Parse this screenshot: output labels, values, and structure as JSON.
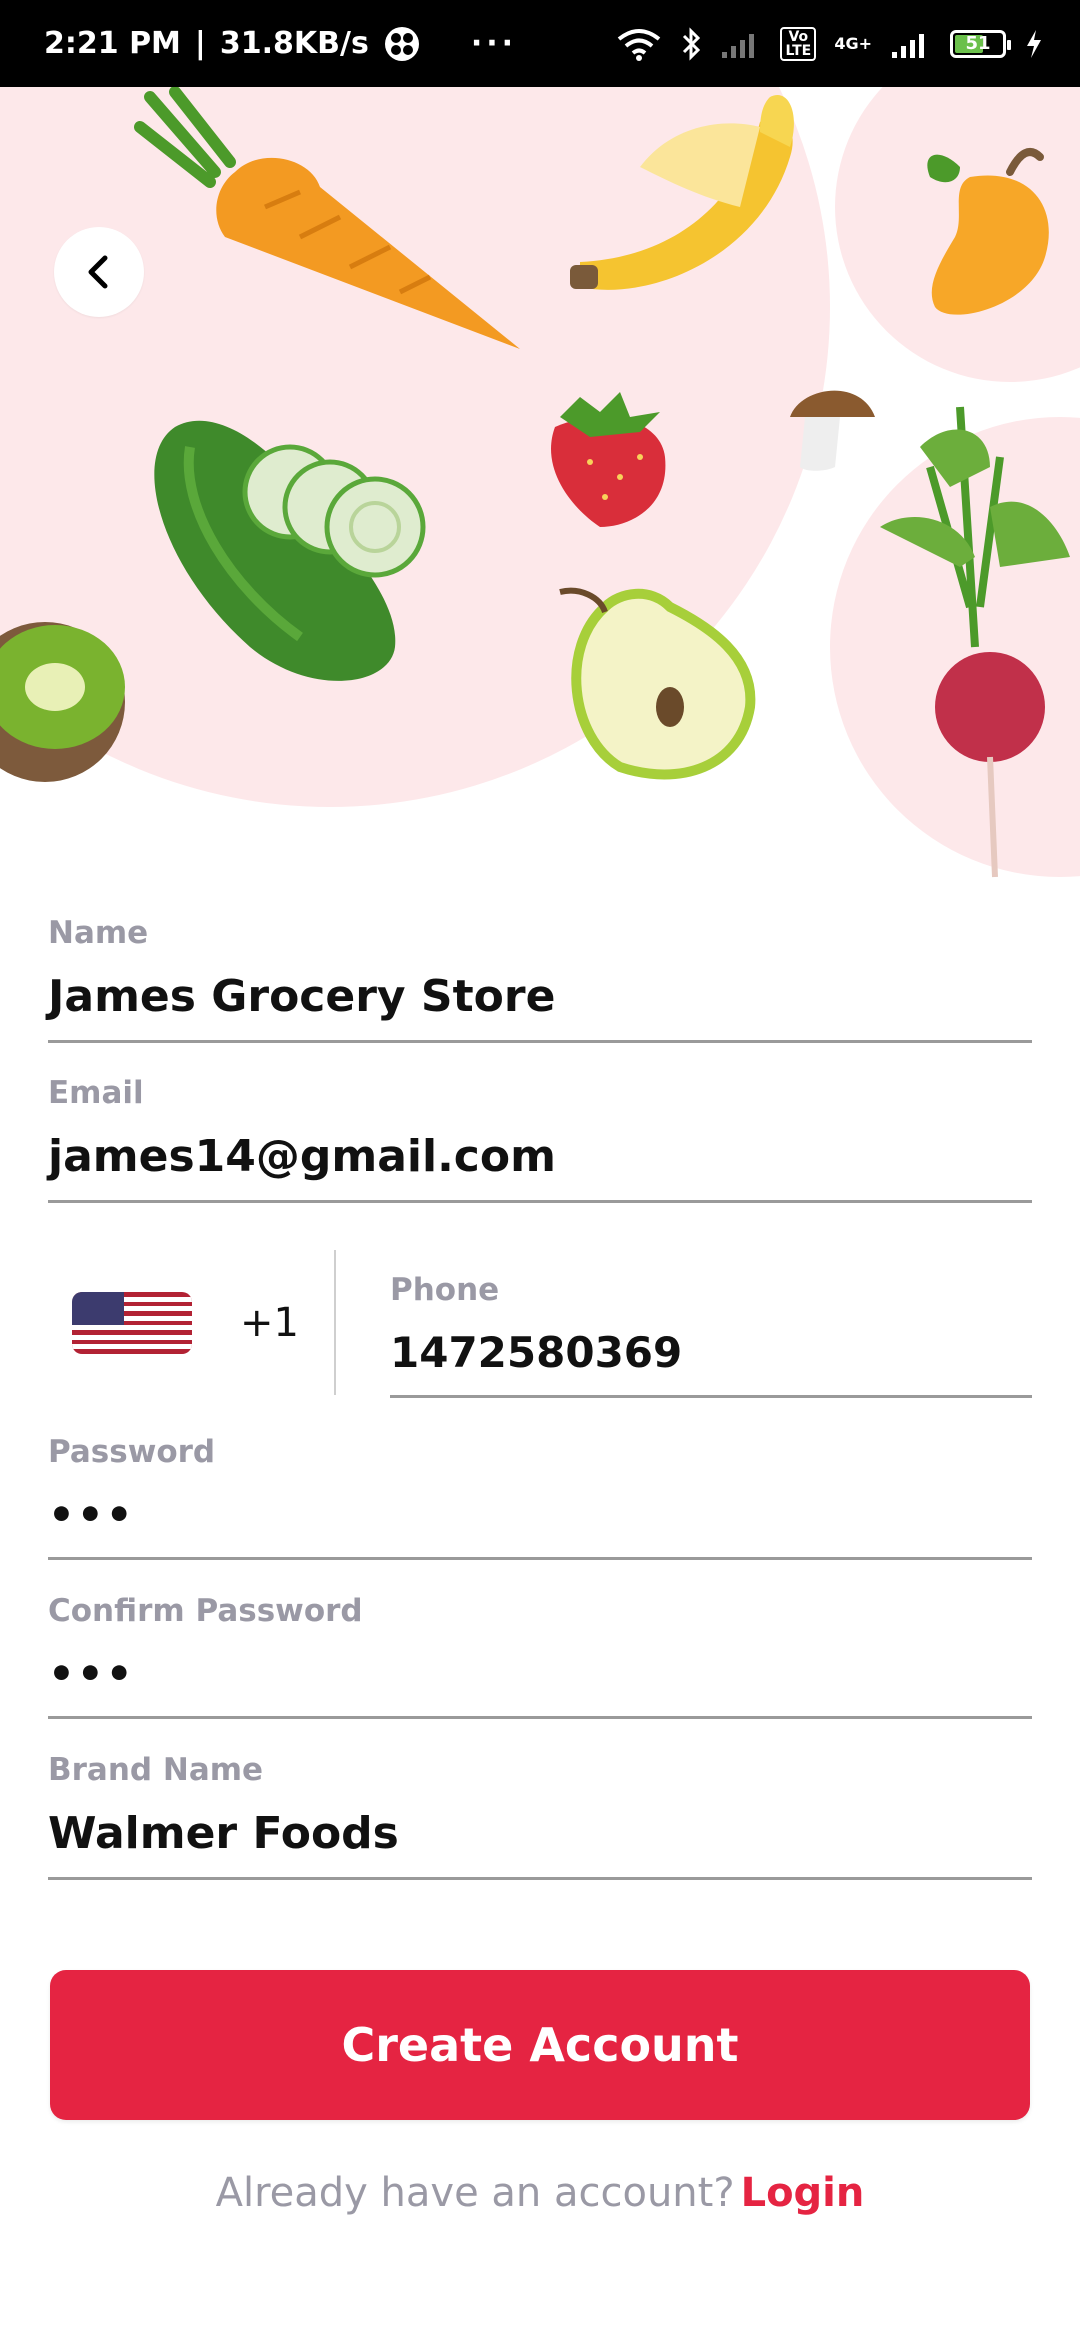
{
  "status_bar": {
    "time": "2:21 PM",
    "speed": "31.8KB/s",
    "more": "···",
    "network": "4G+",
    "volte": "Vo LTE",
    "battery": "51",
    "icons": [
      "wifi-icon",
      "bluetooth-icon",
      "signal-icon",
      "battery-icon",
      "charging-icon"
    ]
  },
  "hero": {
    "back_icon": "chevron-left-icon",
    "illustrations": [
      "carrot",
      "banana",
      "mango",
      "cucumber",
      "strawberry",
      "mushroom",
      "radish",
      "pear",
      "kiwi"
    ]
  },
  "form": {
    "name": {
      "label": "Name",
      "value": "James Grocery Store"
    },
    "email": {
      "label": "Email",
      "value": "james14@gmail.com"
    },
    "phone": {
      "label": "Phone",
      "value": "1472580369",
      "country_code": "+1",
      "flag": "us-flag"
    },
    "password": {
      "label": "Password",
      "value": "•••"
    },
    "confirm_password": {
      "label": "Confirm Password",
      "value": "•••"
    },
    "brand_name": {
      "label": "Brand Name",
      "value": "Walmer Foods"
    }
  },
  "actions": {
    "create_account": "Create Account",
    "already_have_account": "Already have an account?",
    "login": "Login"
  },
  "colors": {
    "accent": "#e52442",
    "label": "#9a99a5",
    "hero_blob": "#fde8ea"
  }
}
